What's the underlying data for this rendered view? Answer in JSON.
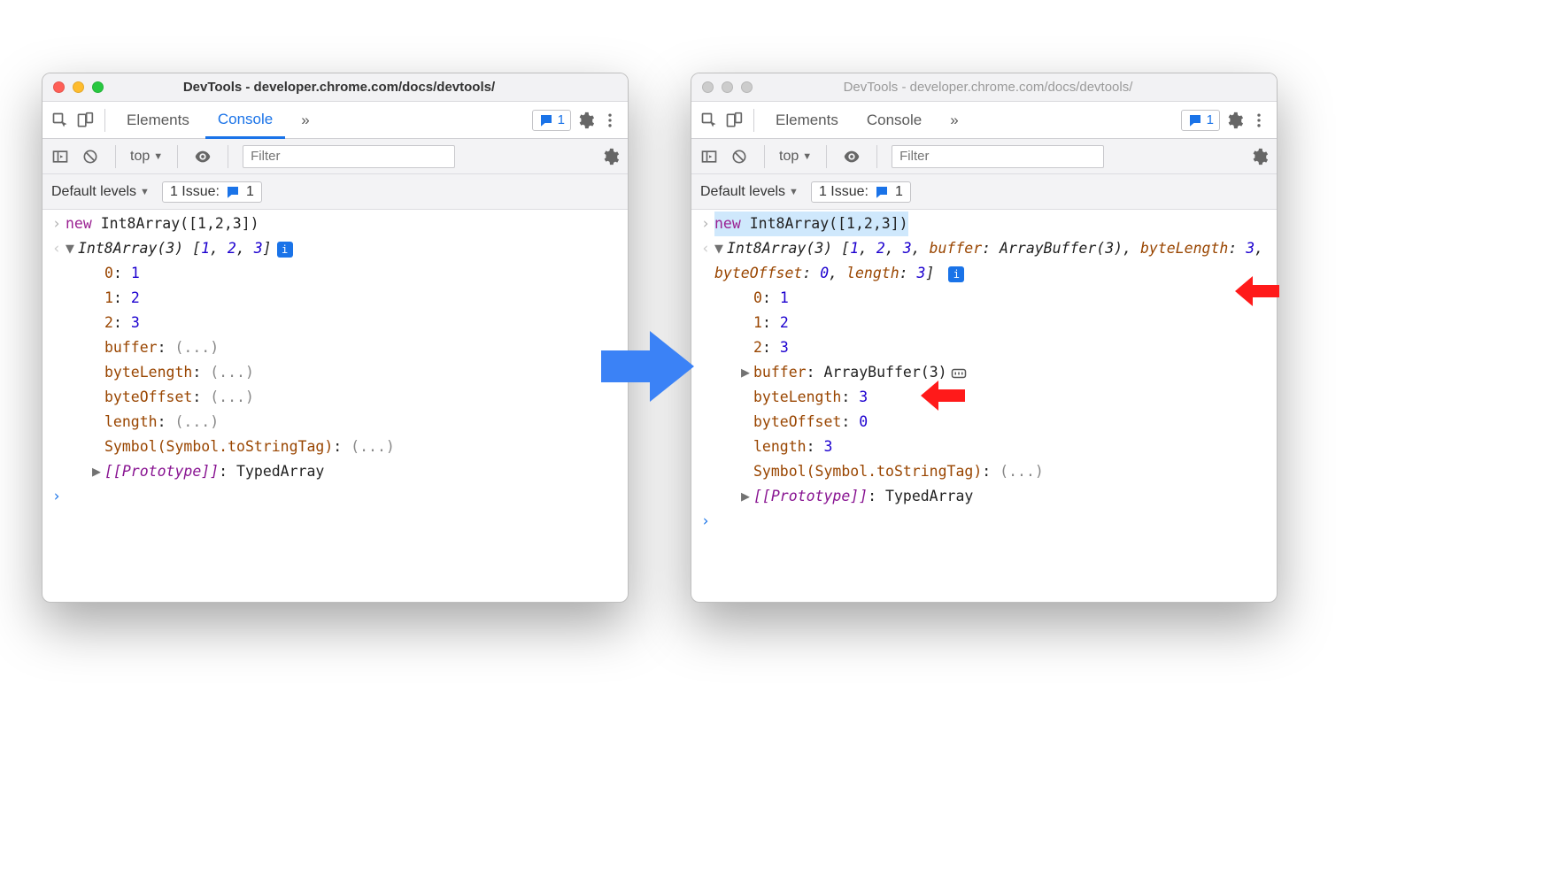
{
  "window_title": "DevTools - developer.chrome.com/docs/devtools/",
  "tabs": {
    "elements": "Elements",
    "console": "Console",
    "more": "»"
  },
  "badge_count": "1",
  "context_label": "top",
  "filter_placeholder": "Filter",
  "default_levels": "Default levels",
  "issues_label": "1 Issue:",
  "issues_count": "1",
  "input_code": {
    "kw": "new",
    "rest": " Int8Array([1,2,3])"
  },
  "left": {
    "summary": {
      "type": "Int8Array(3)",
      "vals": [
        "1",
        "2",
        "3"
      ]
    },
    "entries": [
      {
        "k": "0",
        "v": "1"
      },
      {
        "k": "1",
        "v": "2"
      },
      {
        "k": "2",
        "v": "3"
      }
    ],
    "lazy": [
      "buffer",
      "byteLength",
      "byteOffset",
      "length"
    ],
    "symbol_key": "Symbol(Symbol.toStringTag)",
    "symbol_val": "(...)",
    "proto_key": "[[Prototype]]",
    "proto_val": "TypedArray"
  },
  "right": {
    "summary": {
      "type": "Int8Array(3)",
      "inline": [
        "1",
        "2",
        "3"
      ],
      "extra": [
        {
          "k": "buffer",
          "v": "ArrayBuffer(3)"
        },
        {
          "k": "byteLength",
          "v": "3"
        },
        {
          "k": "byteOffset",
          "v": "0"
        },
        {
          "k": "length",
          "v": "3"
        }
      ]
    },
    "entries": [
      {
        "k": "0",
        "v": "1"
      },
      {
        "k": "1",
        "v": "2"
      },
      {
        "k": "2",
        "v": "3"
      }
    ],
    "buffer": {
      "k": "buffer",
      "v": "ArrayBuffer(3)"
    },
    "resolved": [
      {
        "k": "byteLength",
        "v": "3"
      },
      {
        "k": "byteOffset",
        "v": "0"
      },
      {
        "k": "length",
        "v": "3"
      }
    ],
    "symbol_key": "Symbol(Symbol.toStringTag)",
    "symbol_val": "(...)",
    "proto_key": "[[Prototype]]",
    "proto_val": "TypedArray"
  }
}
